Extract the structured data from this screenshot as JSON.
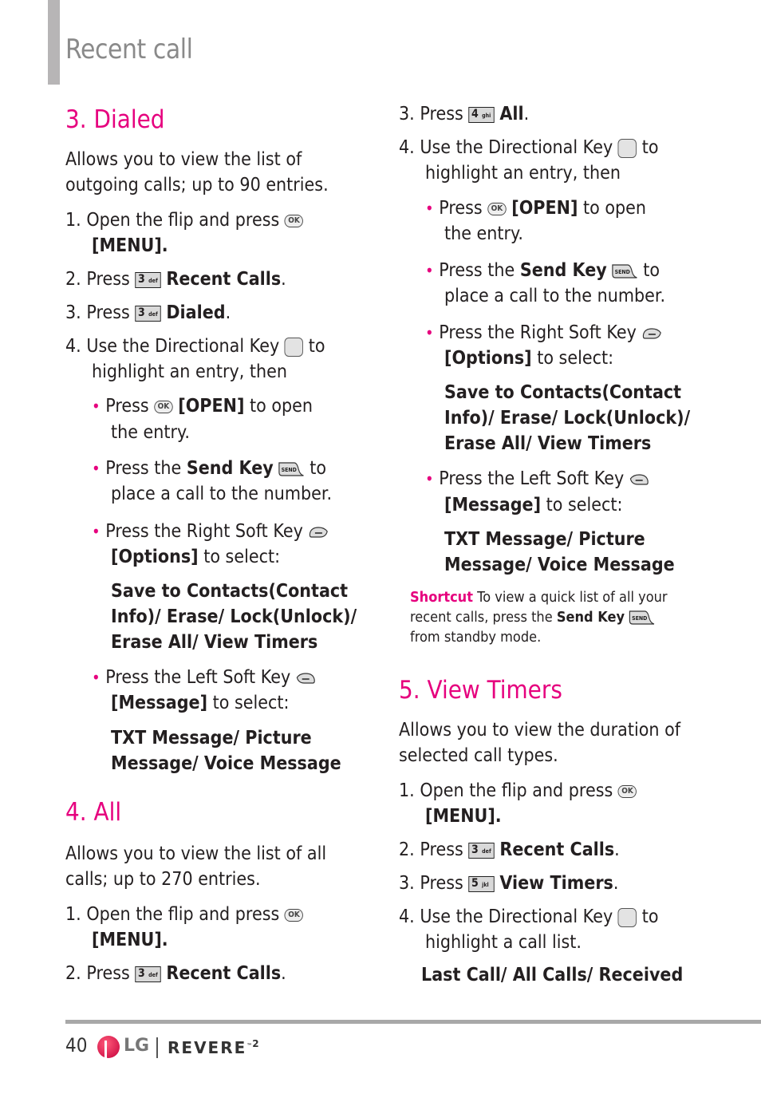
{
  "header": {
    "title": "Recent call"
  },
  "left": {
    "dialed": {
      "heading": "3. Dialed",
      "intro": [
        "Allows you to view the list of",
        "outgoing calls; up to 90 entries."
      ],
      "step1_pre": "1.  Open the flip and press",
      "step1_menu": "[MENU]",
      "step2_pre": "2.  Press",
      "step2_bold": "Recent Calls",
      "step3_pre": "3.  Press",
      "step3_bold": "Dialed",
      "step4_pre": "4.  Use the Directional Key",
      "step4_post": "to",
      "step4_line2": "highlight an entry, then",
      "b1_pre": "Press",
      "b1_bold": "[OPEN]",
      "b1_post": "to open",
      "b1_line2": "the entry.",
      "b2_pre": "Press the",
      "b2_bold": "Send Key",
      "b2_post": "to",
      "b2_line2": "place a call to the number.",
      "b3_pre": "Press the Right Soft Key",
      "b3_bold": "[Options]",
      "b3_post": "to select:",
      "b3_opts": [
        "Save to Contacts(Contact",
        "Info)/ Erase/ Lock(Unlock)/",
        "Erase All/ View Timers"
      ],
      "b4_pre": "Press the Left Soft Key",
      "b4_bold": "[Message]",
      "b4_post": "to select:",
      "b4_opts": [
        "TXT Message/ Picture",
        "Message/ Voice Message"
      ]
    },
    "all": {
      "heading": "4. All",
      "intro": [
        "Allows you to view the list of all",
        "calls; up to 270 entries."
      ],
      "step1_pre": "1.  Open the flip and press",
      "step1_menu": "[MENU]",
      "step2_pre": "2.  Press",
      "step2_bold": "Recent Calls"
    }
  },
  "right": {
    "all_cont": {
      "step3_pre": "3.  Press",
      "step3_bold": "All",
      "step4_pre": "4.  Use the Directional Key",
      "step4_post": "to",
      "step4_line2": "highlight an entry, then",
      "b1_pre": "Press",
      "b1_bold": "[OPEN]",
      "b1_post": "to open",
      "b1_line2": "the entry.",
      "b2_pre": "Press the",
      "b2_bold": "Send Key",
      "b2_post": "to",
      "b2_line2": "place a call to the number.",
      "b3_pre": "Press the Right Soft Key",
      "b3_bold": "[Options]",
      "b3_post": "to select:",
      "b3_opts": [
        "Save to Contacts(Contact",
        "Info)/ Erase/ Lock(Unlock)/",
        "Erase All/ View Timers"
      ],
      "b4_pre": "Press the Left Soft Key",
      "b4_bold": "[Message]",
      "b4_post": "to select:",
      "b4_opts": [
        "TXT Message/ Picture",
        "Message/ Voice Message"
      ]
    },
    "shortcut": {
      "label": "Shortcut",
      "line1": "To view a quick list of all your",
      "line2_pre": "recent calls, press the",
      "line2_bold": "Send Key",
      "line3": "from standby mode."
    },
    "timers": {
      "heading": "5. View Timers",
      "intro": [
        "Allows you to view the duration of",
        "selected call types."
      ],
      "step1_pre": "1.  Open the flip and press",
      "step1_menu": "[MENU]",
      "step2_pre": "2.  Press",
      "step2_bold": "Recent Calls",
      "step3_pre": "3.  Press",
      "step3_bold": "View Timers",
      "step4_pre": "4.  Use the Directional Key",
      "step4_post": "to",
      "step4_line2": "highlight a call list.",
      "options": "Last Call/ All Calls/ Received"
    }
  },
  "keys": {
    "ok": "OK",
    "key3_num": "3",
    "key3_sub": "def",
    "key4_num": "4",
    "key4_sub": "ghi",
    "key5_num": "5",
    "key5_sub": "jkl",
    "send": "SEND"
  },
  "footer": {
    "page_number": "40",
    "brand": "LG",
    "product": "REVERE",
    "product_tm": "™",
    "product_suffix": "2"
  },
  "colors": {
    "accent": "#e6007e",
    "title_gray": "#8a8a8a",
    "rule_gray": "#a8a8a8"
  }
}
